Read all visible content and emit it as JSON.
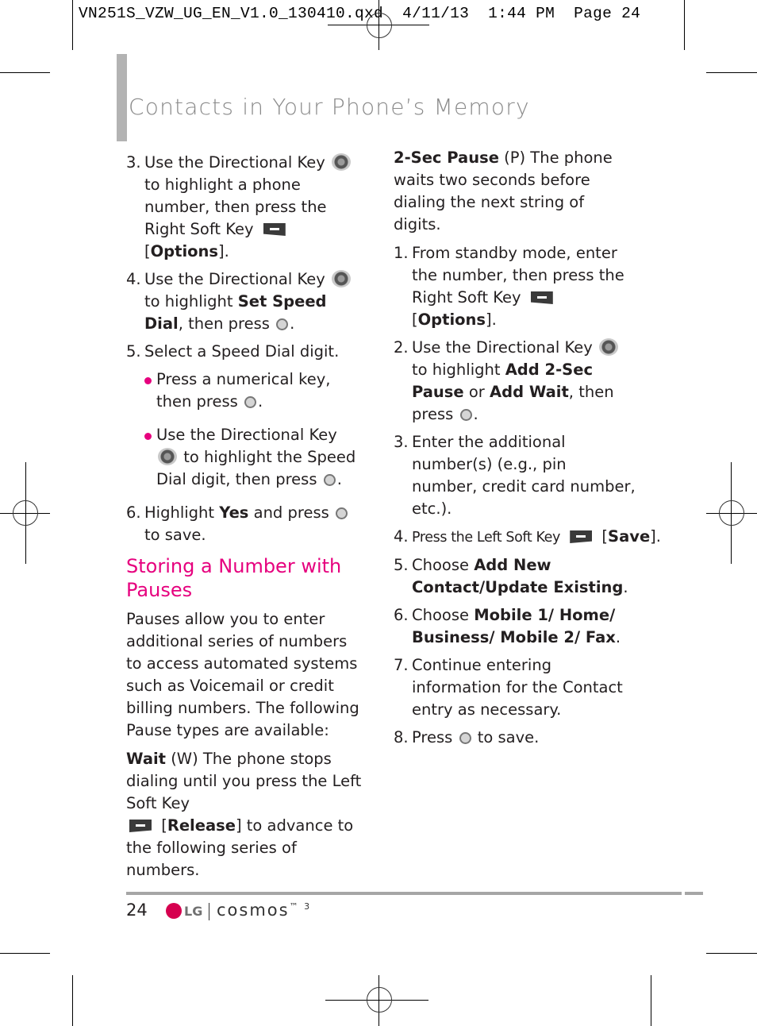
{
  "slug_line": {
    "filename": "VN251S_VZW_UG_EN_V1.0_130410.qxd",
    "date": "4/11/13",
    "time": "1:44 PM",
    "page_label": "Page 24"
  },
  "header": {
    "title": "Contacts in Your Phone’s Memory"
  },
  "left_column": {
    "step3": {
      "num": "3.",
      "t1": "Use the Directional Key",
      "t2": "to highlight a phone number, then press the Right Soft Key",
      "t3": "[",
      "b1": "Options",
      "t4": "]."
    },
    "step4": {
      "num": "4.",
      "t1": "Use the Directional Key",
      "t2": "to highlight",
      "b1": "Set Speed Dial",
      "t3": ", then press",
      "t4": "."
    },
    "step5": {
      "num": "5.",
      "t1": "Select a Speed Dial digit."
    },
    "bullet1": {
      "t1": "Press a numerical key, then press",
      "t2": "."
    },
    "bullet2": {
      "t1": "Use the Directional Key",
      "t2": "to highlight the Speed Dial digit, then press",
      "t3": "."
    },
    "step6": {
      "num": "6.",
      "t1": "Highlight",
      "b1": "Yes",
      "t2": "and press",
      "t3": "to save."
    },
    "section_heading": "Storing a Number with Pauses",
    "intro": "Pauses allow you to enter additional series of numbers to access automated systems such as Voicemail or credit billing numbers. The following Pause types are available:",
    "wait": {
      "b1": "Wait",
      "t1": "(W) The phone stops dialing until you press the Left Soft Key",
      "t2": "[",
      "b2": "Release",
      "t3": "] to advance to the following series of numbers."
    }
  },
  "right_column": {
    "pause": {
      "b1": "2-Sec Pause",
      "t1": "(P) The phone waits two seconds before dialing the next string of digits."
    },
    "step1": {
      "num": "1.",
      "t1": "From standby mode, enter the number, then press the Right Soft Key",
      "t2": "[",
      "b1": "Options",
      "t3": "]."
    },
    "step2": {
      "num": "2.",
      "t1": "Use the Directional Key",
      "t2": "to highlight",
      "b1": "Add 2-Sec Pause",
      "t3": "or",
      "b2": "Add Wait",
      "t4": ", then press",
      "t5": "."
    },
    "step3": {
      "num": "3.",
      "t1": "Enter the additional number(s) (e.g., pin number, credit card number, etc.)."
    },
    "step4": {
      "num": "4.",
      "t1": "Press the Left Soft Key",
      "t2": "[",
      "b1": "Save",
      "t3": "]."
    },
    "step5": {
      "num": "5.",
      "t1": "Choose",
      "b1": "Add New Contact/Update Existing",
      "t2": "."
    },
    "step6": {
      "num": "6.",
      "t1": "Choose",
      "b1": "Mobile 1/ Home/ Business/ Mobile 2/ Fax",
      "t2": "."
    },
    "step7": {
      "num": "7.",
      "t1": "Continue entering information for the Contact entry as necessary."
    },
    "step8": {
      "num": "8.",
      "t1": "Press",
      "t2": "to save."
    }
  },
  "footer": {
    "page_number": "24",
    "lg_text": "LG",
    "brand": "cosmos",
    "brand_sup": "™ 3"
  },
  "colors": {
    "accent_magenta": "#e6007e",
    "title_gray": "#8a8a8a",
    "rule_gray": "#a6a6a6"
  }
}
